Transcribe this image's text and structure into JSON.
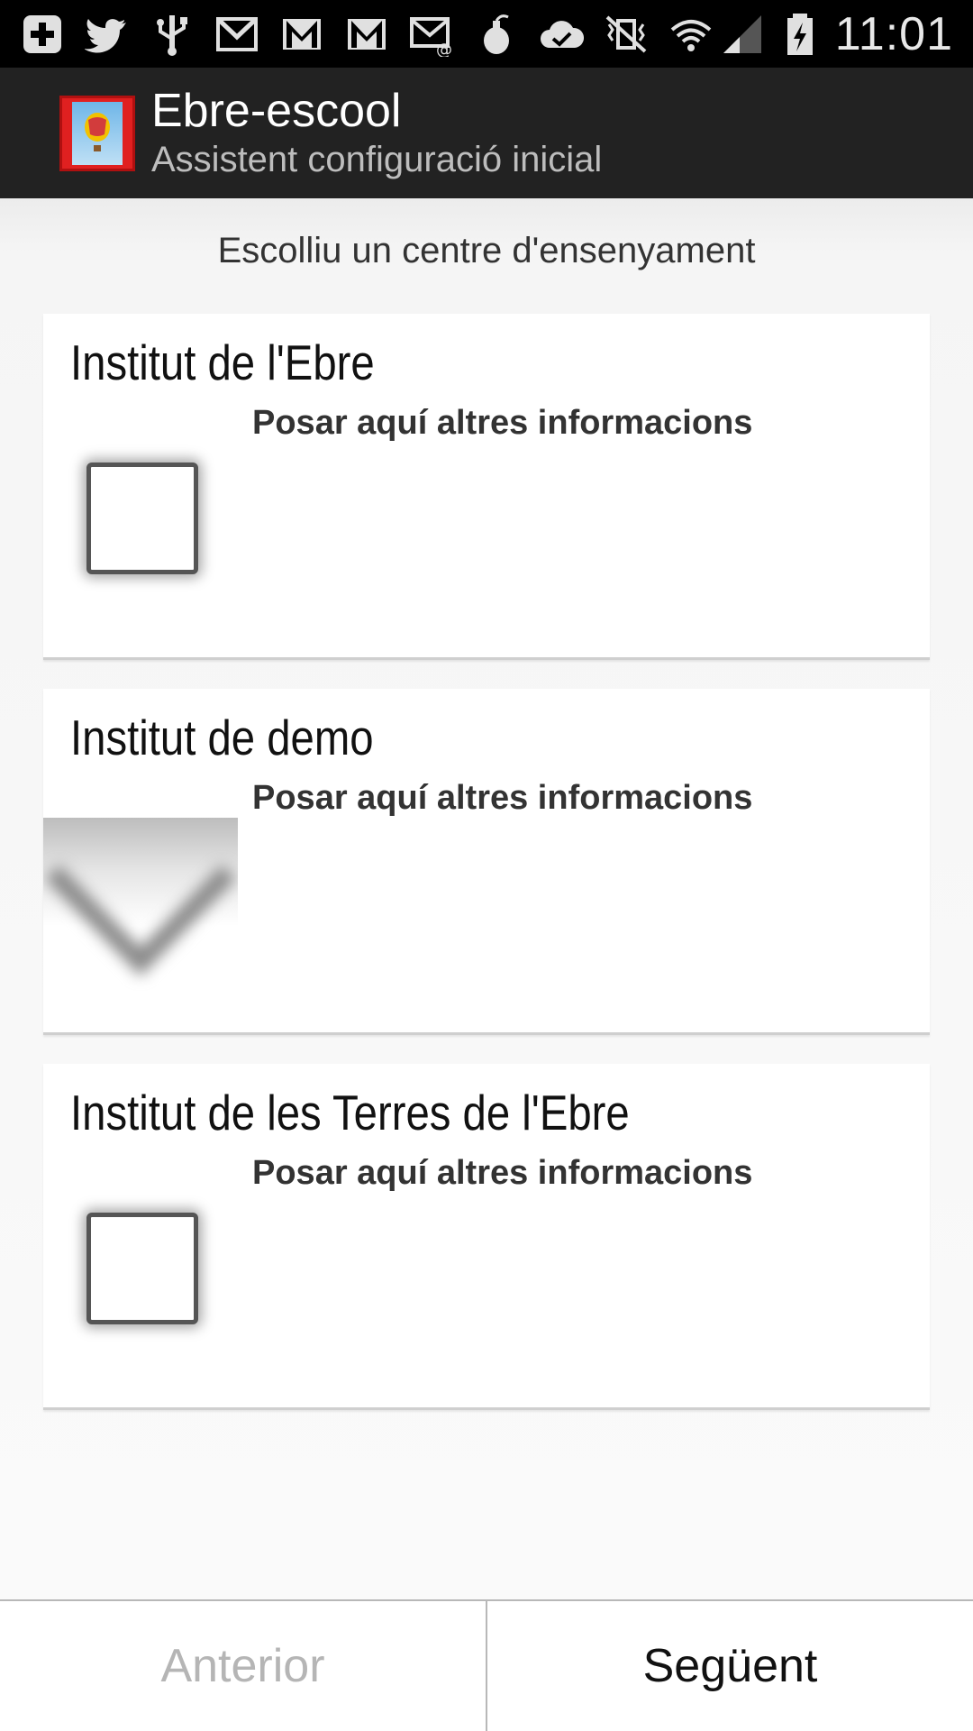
{
  "status_bar": {
    "icons": [
      "add-icon",
      "twitter-icon",
      "usb-icon",
      "gmail-icon",
      "gmail-icon",
      "gmail-icon",
      "email-icon",
      "bomb-icon",
      "cloud-check-icon",
      "vibrate-icon",
      "wifi-icon",
      "signal-icon",
      "battery-charging-icon"
    ],
    "time": "11:01"
  },
  "action_bar": {
    "title": "Ebre-escool",
    "subtitle": "Assistent configuració inicial"
  },
  "prompt": "Escolliu un centre d'ensenyament",
  "cards": [
    {
      "title": "Institut de l'Ebre",
      "info": "Posar aquí altres informacions",
      "widget": "checkbox"
    },
    {
      "title": "Institut de demo",
      "info": "Posar aquí altres informacions",
      "widget": "dropdown-arrow"
    },
    {
      "title": "Institut de les Terres de l'Ebre",
      "info": "Posar aquí altres informacions",
      "widget": "checkbox"
    }
  ],
  "buttons": {
    "previous": "Anterior",
    "next": "Següent"
  },
  "colors": {
    "status_bar": "#000000",
    "action_bar": "#222222",
    "background": "#f5f5f5",
    "disabled_text": "#b5b5b5"
  }
}
